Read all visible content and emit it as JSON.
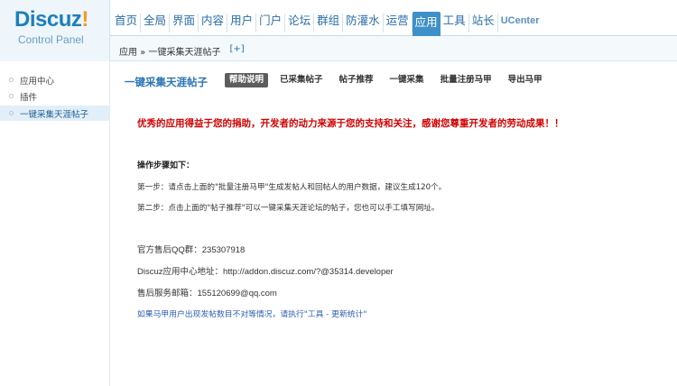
{
  "brand": {
    "logo_main": "Discuz",
    "logo_bang": "!",
    "logo_sub": "Control Panel"
  },
  "topnav": {
    "items": [
      "首页",
      "全局",
      "界面",
      "内容",
      "用户",
      "门户",
      "论坛",
      "群组",
      "防灌水",
      "运营",
      "应用",
      "工具",
      "站长",
      "UCenter"
    ],
    "active": "应用"
  },
  "breadcrumb": {
    "path": "应用 » 一键采集天涯帖子",
    "add": "[+]"
  },
  "sidebar": {
    "items": [
      {
        "label": "应用中心"
      },
      {
        "label": "插件"
      },
      {
        "label": "一键采集天涯帖子"
      }
    ],
    "active_index": 2
  },
  "main": {
    "plugin_title": "一键采集天涯帖子",
    "tabs": [
      "帮助说明",
      "已采集帖子",
      "帖子推荐",
      "一键采集",
      "批量注册马甲",
      "导出马甲"
    ],
    "active_tab": "帮助说明",
    "notice": "优秀的应用得益于您的捐助，开发者的动力来源于您的支持和关注，感谢您尊重开发者的劳动成果！！",
    "steps_title": "操作步骤如下：",
    "step1": "第一步：请点击上面的\"批量注册马甲\"生成发帖人和回帖人的用户数据，建议生成120个。",
    "step2": "第二步：点击上面的\"帖子推荐\"可以一键采集天涯论坛的帖子，您也可以手工填写网址。",
    "qq_group": "官方售后QQ群：235307918",
    "app_center_url": "Discuz应用中心地址：http://addon.discuz.com/?@35314.developer",
    "support_email": "售后服务邮箱：155120699@qq.com",
    "fix_link": "如果马甲用户出现发帖数目不对等情况，请执行\"工具 - 更新统计\""
  }
}
